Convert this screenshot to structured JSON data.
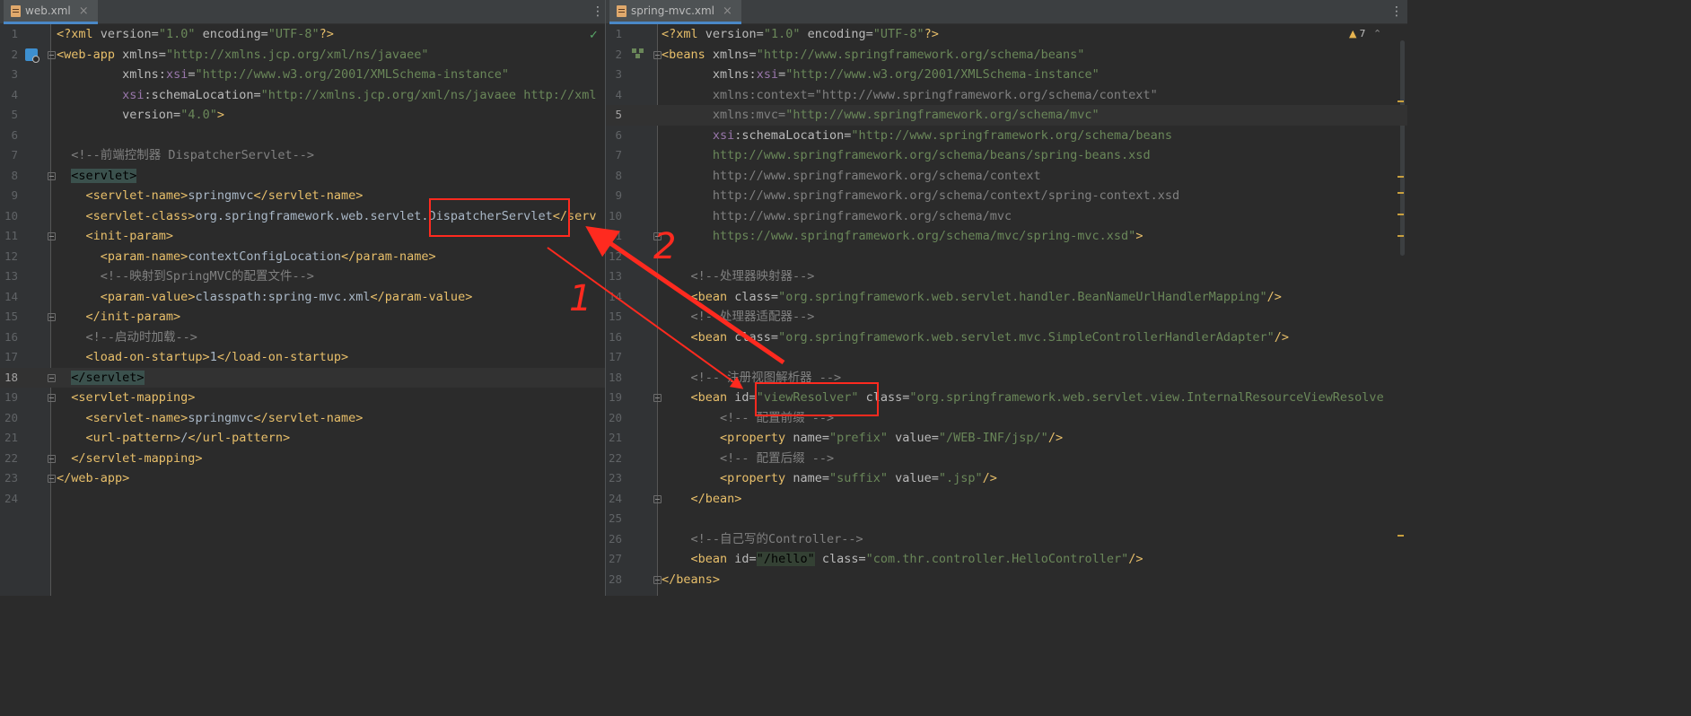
{
  "left_pane": {
    "tab_label": "web.xml",
    "close_glyph": "×",
    "status_glyph": "✓",
    "lines": [
      {
        "n": "1",
        "parts": [
          [
            "p",
            "<?"
          ],
          [
            "t",
            "xml "
          ],
          [
            "a",
            "version="
          ],
          [
            "v",
            "\"1.0\""
          ],
          [
            "a",
            " encoding="
          ],
          [
            "v",
            "\"UTF-8\""
          ],
          [
            "p",
            "?>"
          ]
        ]
      },
      {
        "n": "2",
        "parts": [
          [
            "t",
            "<web-app "
          ],
          [
            "a",
            "xmlns="
          ],
          [
            "v",
            "\"http://xmlns.jcp.org/xml/ns/javaee\""
          ]
        ]
      },
      {
        "n": "3",
        "parts": [
          [
            "x",
            "         "
          ],
          [
            "a",
            "xmlns:"
          ],
          [
            "ns",
            "xsi"
          ],
          [
            "a",
            "="
          ],
          [
            "v",
            "\"http://www.w3.org/2001/XMLSchema-instance\""
          ]
        ]
      },
      {
        "n": "4",
        "parts": [
          [
            "x",
            "         "
          ],
          [
            "ns",
            "xsi"
          ],
          [
            "a",
            ":schemaLocation="
          ],
          [
            "v",
            "\"http://xmlns.jcp.org/xml/ns/javaee http://xml"
          ]
        ]
      },
      {
        "n": "5",
        "parts": [
          [
            "x",
            "         "
          ],
          [
            "a",
            "version="
          ],
          [
            "v",
            "\"4.0\""
          ],
          [
            "t",
            ">"
          ]
        ]
      },
      {
        "n": "6",
        "parts": []
      },
      {
        "n": "7",
        "parts": [
          [
            "x",
            "  "
          ],
          [
            "c",
            "<!--前端控制器 DispatcherServlet-->"
          ]
        ]
      },
      {
        "n": "8",
        "parts": [
          [
            "x",
            "  "
          ],
          [
            "hl",
            "<servlet>"
          ]
        ]
      },
      {
        "n": "9",
        "parts": [
          [
            "x",
            "    "
          ],
          [
            "t",
            "<servlet-name>"
          ],
          [
            "x",
            "springmvc"
          ],
          [
            "t",
            "</servlet-name>"
          ]
        ]
      },
      {
        "n": "10",
        "parts": [
          [
            "x",
            "    "
          ],
          [
            "t",
            "<servlet-class>"
          ],
          [
            "x",
            "org.springframework.web.servlet.DispatcherServlet"
          ],
          [
            "t",
            "</serv"
          ]
        ]
      },
      {
        "n": "11",
        "parts": [
          [
            "x",
            "    "
          ],
          [
            "t",
            "<init-param>"
          ]
        ]
      },
      {
        "n": "12",
        "parts": [
          [
            "x",
            "      "
          ],
          [
            "t",
            "<param-name>"
          ],
          [
            "x",
            "contextConfigLocation"
          ],
          [
            "t",
            "</param-name>"
          ]
        ]
      },
      {
        "n": "13",
        "parts": [
          [
            "x",
            "      "
          ],
          [
            "c",
            "<!--映射到SpringMVC的配置文件-->"
          ]
        ]
      },
      {
        "n": "14",
        "parts": [
          [
            "x",
            "      "
          ],
          [
            "t",
            "<param-value>"
          ],
          [
            "x",
            "classpath:spring-mvc.xml"
          ],
          [
            "t",
            "</param-value>"
          ]
        ]
      },
      {
        "n": "15",
        "parts": [
          [
            "x",
            "    "
          ],
          [
            "t",
            "</init-param>"
          ]
        ]
      },
      {
        "n": "16",
        "parts": [
          [
            "x",
            "    "
          ],
          [
            "c",
            "<!--启动时加载-->"
          ]
        ]
      },
      {
        "n": "17",
        "parts": [
          [
            "x",
            "    "
          ],
          [
            "t",
            "<load-on-startup>"
          ],
          [
            "x",
            "1"
          ],
          [
            "t",
            "</load-on-startup>"
          ]
        ]
      },
      {
        "n": "18",
        "parts": [
          [
            "x",
            "  "
          ],
          [
            "hl",
            "</servlet>"
          ]
        ]
      },
      {
        "n": "19",
        "parts": [
          [
            "x",
            "  "
          ],
          [
            "t",
            "<servlet-mapping>"
          ]
        ]
      },
      {
        "n": "20",
        "parts": [
          [
            "x",
            "    "
          ],
          [
            "t",
            "<servlet-name>"
          ],
          [
            "x",
            "springmvc"
          ],
          [
            "t",
            "</servlet-name>"
          ]
        ]
      },
      {
        "n": "21",
        "parts": [
          [
            "x",
            "    "
          ],
          [
            "t",
            "<url-pattern>"
          ],
          [
            "x",
            "/"
          ],
          [
            "t",
            "</url-pattern>"
          ]
        ]
      },
      {
        "n": "22",
        "parts": [
          [
            "x",
            "  "
          ],
          [
            "t",
            "</servlet-mapping>"
          ]
        ]
      },
      {
        "n": "23",
        "parts": [
          [
            "t",
            "</web-app>"
          ]
        ]
      },
      {
        "n": "24",
        "parts": []
      }
    ],
    "current_line": "18"
  },
  "right_pane": {
    "tab_label": "spring-mvc.xml",
    "close_glyph": "×",
    "warning_glyph": "▲",
    "warning_count": "7",
    "nav_glyph": "⌃",
    "lines": [
      {
        "n": "1",
        "parts": [
          [
            "p",
            "<?"
          ],
          [
            "t",
            "xml "
          ],
          [
            "a",
            "version="
          ],
          [
            "v",
            "\"1.0\""
          ],
          [
            "a",
            " encoding="
          ],
          [
            "v",
            "\"UTF-8\""
          ],
          [
            "p",
            "?>"
          ]
        ]
      },
      {
        "n": "2",
        "parts": [
          [
            "t",
            "<beans "
          ],
          [
            "a",
            "xmlns="
          ],
          [
            "v",
            "\"http://www.springframework.org/schema/beans\""
          ]
        ]
      },
      {
        "n": "3",
        "parts": [
          [
            "x",
            "       "
          ],
          [
            "a",
            "xmlns:"
          ],
          [
            "ns",
            "xsi"
          ],
          [
            "a",
            "="
          ],
          [
            "v",
            "\"http://www.w3.org/2001/XMLSchema-instance\""
          ]
        ]
      },
      {
        "n": "4",
        "parts": [
          [
            "x",
            "       "
          ],
          [
            "c",
            "xmlns:context=\"http://www.springframework.org/schema/context\""
          ]
        ]
      },
      {
        "n": "5",
        "parts": [
          [
            "x",
            "       "
          ],
          [
            "c",
            "xmlns:mvc="
          ],
          [
            "v",
            "\"http://www.springframework.org/schema/mvc\""
          ]
        ]
      },
      {
        "n": "6",
        "parts": [
          [
            "x",
            "       "
          ],
          [
            "ns",
            "xsi"
          ],
          [
            "a",
            ":schemaLocation="
          ],
          [
            "v",
            "\"http://www.springframework.org/schema/beans"
          ]
        ]
      },
      {
        "n": "7",
        "parts": [
          [
            "x",
            "       "
          ],
          [
            "v",
            "http://www.springframework.org/schema/beans/spring-beans.xsd"
          ]
        ]
      },
      {
        "n": "8",
        "parts": [
          [
            "x",
            "       "
          ],
          [
            "c",
            "http://www.springframework.org/schema/context"
          ]
        ]
      },
      {
        "n": "9",
        "parts": [
          [
            "x",
            "       "
          ],
          [
            "c",
            "http://www.springframework.org/schema/context/spring-context.xsd"
          ]
        ]
      },
      {
        "n": "10",
        "parts": [
          [
            "x",
            "       "
          ],
          [
            "c",
            "http://www.springframework.org/schema/mvc"
          ]
        ]
      },
      {
        "n": "11",
        "parts": [
          [
            "x",
            "       "
          ],
          [
            "v",
            "https://www.springframework.org/schema/mvc/spring-mvc.xsd\""
          ],
          [
            "t",
            ">"
          ]
        ]
      },
      {
        "n": "12",
        "parts": []
      },
      {
        "n": "13",
        "parts": [
          [
            "x",
            "    "
          ],
          [
            "c",
            "<!--处理器映射器-->"
          ]
        ]
      },
      {
        "n": "14",
        "parts": [
          [
            "x",
            "    "
          ],
          [
            "t",
            "<bean "
          ],
          [
            "a",
            "class="
          ],
          [
            "v",
            "\"org.springframework.web.servlet.handler.BeanNameUrlHandlerMapping\""
          ],
          [
            "t",
            "/>"
          ]
        ]
      },
      {
        "n": "15",
        "parts": [
          [
            "x",
            "    "
          ],
          [
            "c",
            "<!--处理器适配器-->"
          ]
        ]
      },
      {
        "n": "16",
        "parts": [
          [
            "x",
            "    "
          ],
          [
            "t",
            "<bean "
          ],
          [
            "a",
            "class="
          ],
          [
            "v",
            "\"org.springframework.web.servlet.mvc.SimpleControllerHandlerAdapter\""
          ],
          [
            "t",
            "/>"
          ]
        ]
      },
      {
        "n": "17",
        "parts": []
      },
      {
        "n": "18",
        "parts": [
          [
            "x",
            "    "
          ],
          [
            "c",
            "<!-- 注册视图解析器 -->"
          ]
        ]
      },
      {
        "n": "19",
        "parts": [
          [
            "x",
            "    "
          ],
          [
            "t",
            "<bean "
          ],
          [
            "a",
            "id="
          ],
          [
            "v",
            "\"viewResolver\""
          ],
          [
            "a",
            " class="
          ],
          [
            "v",
            "\"org.springframework.web.servlet.view.InternalResourceViewResolve"
          ]
        ]
      },
      {
        "n": "20",
        "parts": [
          [
            "x",
            "        "
          ],
          [
            "c",
            "<!-- 配置前缀 -->"
          ]
        ]
      },
      {
        "n": "21",
        "parts": [
          [
            "x",
            "        "
          ],
          [
            "t",
            "<property "
          ],
          [
            "a",
            "name="
          ],
          [
            "v",
            "\"prefix\""
          ],
          [
            "a",
            " value="
          ],
          [
            "v",
            "\"/WEB-INF/jsp/\""
          ],
          [
            "t",
            "/>"
          ]
        ]
      },
      {
        "n": "22",
        "parts": [
          [
            "x",
            "        "
          ],
          [
            "c",
            "<!-- 配置后缀 -->"
          ]
        ]
      },
      {
        "n": "23",
        "parts": [
          [
            "x",
            "        "
          ],
          [
            "t",
            "<property "
          ],
          [
            "a",
            "name="
          ],
          [
            "v",
            "\"suffix\""
          ],
          [
            "a",
            " value="
          ],
          [
            "v",
            "\".jsp\""
          ],
          [
            "t",
            "/>"
          ]
        ]
      },
      {
        "n": "24",
        "parts": [
          [
            "x",
            "    "
          ],
          [
            "t",
            "</bean>"
          ]
        ]
      },
      {
        "n": "25",
        "parts": []
      },
      {
        "n": "26",
        "parts": [
          [
            "x",
            "    "
          ],
          [
            "c",
            "<!--自己写的Controller-->"
          ]
        ]
      },
      {
        "n": "27",
        "parts": [
          [
            "x",
            "    "
          ],
          [
            "t",
            "<bean "
          ],
          [
            "a",
            "id="
          ],
          [
            "hlv",
            "\"/hello\""
          ],
          [
            "a",
            " class="
          ],
          [
            "v",
            "\"com.thr.controller.HelloController\""
          ],
          [
            "t",
            "/>"
          ]
        ]
      },
      {
        "n": "28",
        "parts": [
          [
            "t",
            "</beans>"
          ]
        ]
      }
    ],
    "current_line": "5"
  },
  "annotations": {
    "color": "#ff2a1f",
    "label_1": "1",
    "label_2": "2"
  }
}
